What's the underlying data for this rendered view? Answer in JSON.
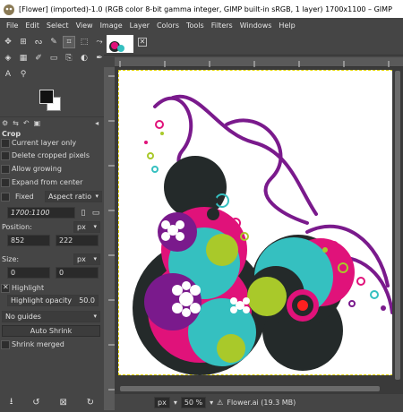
{
  "window": {
    "title": "[Flower] (imported)-1.0 (RGB color 8-bit gamma integer, GIMP built-in sRGB, 1 layer) 1700x1100 – GIMP"
  },
  "menu": [
    "File",
    "Edit",
    "Select",
    "View",
    "Image",
    "Layer",
    "Colors",
    "Tools",
    "Filters",
    "Windows",
    "Help"
  ],
  "toolbox": {
    "row1": [
      "move-icon",
      "align-icon",
      "free-select-icon",
      "fuzzy-select-icon",
      "crop-icon",
      "unified-transform-icon",
      "warp-icon"
    ],
    "row2": [
      "paint-bucket-icon",
      "gradient-icon",
      "paintbrush-icon",
      "eraser-icon",
      "clone-icon",
      "dodge-icon",
      "path-icon"
    ],
    "row3": [
      "text-icon",
      "color-picker-icon"
    ]
  },
  "dock_tabs": {
    "tool_options": "Crop"
  },
  "crop_options": {
    "title": "Crop",
    "current_layer_only": "Current layer only",
    "delete_cropped_pixels": "Delete cropped pixels",
    "allow_growing": "Allow growing",
    "expand_from_center": "Expand from center",
    "fixed_label": "Fixed",
    "fixed_mode": "Aspect ratio",
    "ratio_value": "1700:1100",
    "position_label": "Position:",
    "position_unit": "px",
    "position_x": "852",
    "position_y": "222",
    "size_label": "Size:",
    "size_unit": "px",
    "size_w": "0",
    "size_h": "0",
    "highlight_label": "Highlight",
    "highlight_opacity_label": "Highlight opacity",
    "highlight_opacity_value": "50.0",
    "guides": "No guides",
    "auto_shrink": "Auto Shrink",
    "shrink_merged": "Shrink merged"
  },
  "status": {
    "unit": "px",
    "zoom": "50 %",
    "file_info": "Flower.ai (19.3 MB)"
  },
  "colors": {
    "bg": "#454545",
    "fg_color": "#111111",
    "bg_color": "#ffffff",
    "magenta": "#e0127a",
    "cyan": "#35c0c0",
    "purple": "#7a1a8c",
    "lime": "#a9c92a",
    "dark": "#242a2a"
  }
}
